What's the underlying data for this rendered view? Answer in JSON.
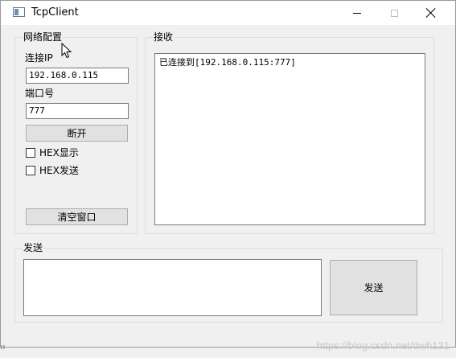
{
  "window": {
    "title": "TcpClient",
    "icon": "app-window-icon",
    "controls": [
      "minimize-icon",
      "maximize-icon",
      "close-icon"
    ]
  },
  "network_config": {
    "title": "网络配置",
    "ip_label": "连接IP",
    "ip_value": "192.168.0.115",
    "port_label": "端口号",
    "port_value": "777",
    "connect_button": "断开",
    "hex_display_label": "HEX显示",
    "hex_display_checked": false,
    "hex_send_label": "HEX发送",
    "hex_send_checked": false,
    "clear_button": "清空窗口"
  },
  "receive": {
    "title": "接收",
    "content": "已连接到[192.168.0.115:777]"
  },
  "send": {
    "title": "发送",
    "content": "",
    "send_button": "发送"
  },
  "watermark": {
    "text": "https://blog.csdn.net/dwh131"
  }
}
